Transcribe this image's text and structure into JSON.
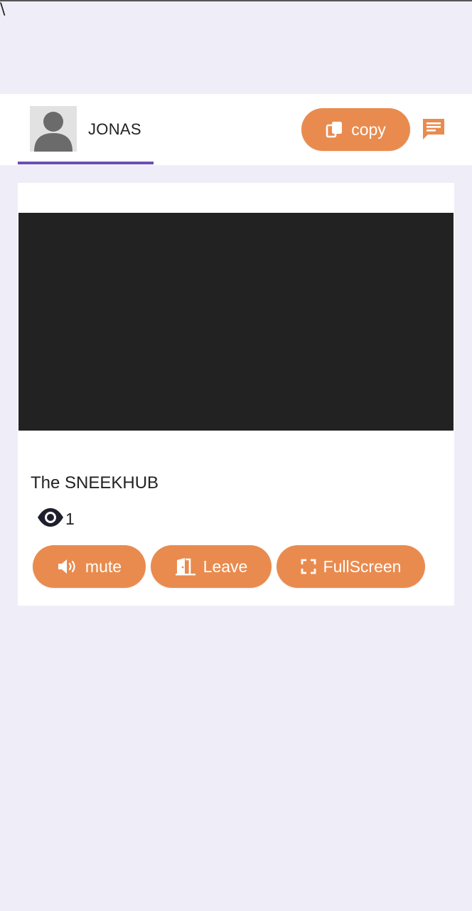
{
  "top_text": "\\",
  "header": {
    "username": "JONAS",
    "copy_label": "copy"
  },
  "stream": {
    "title": "The SNEEKHUB",
    "viewer_count": "1"
  },
  "controls": {
    "mute_label": "mute",
    "leave_label": "Leave",
    "fullscreen_label": "FullScreen"
  },
  "colors": {
    "accent": "#e98b4e",
    "tab_underline": "#6d4fb4",
    "background": "#efedf7",
    "video_bg": "#222222"
  },
  "icons": {
    "avatar": "person-placeholder-icon",
    "copy": "copy-icon",
    "chat": "chat-icon",
    "viewers": "eye-icon",
    "mute": "speaker-icon",
    "leave": "door-exit-icon",
    "fullscreen": "fullscreen-icon"
  }
}
